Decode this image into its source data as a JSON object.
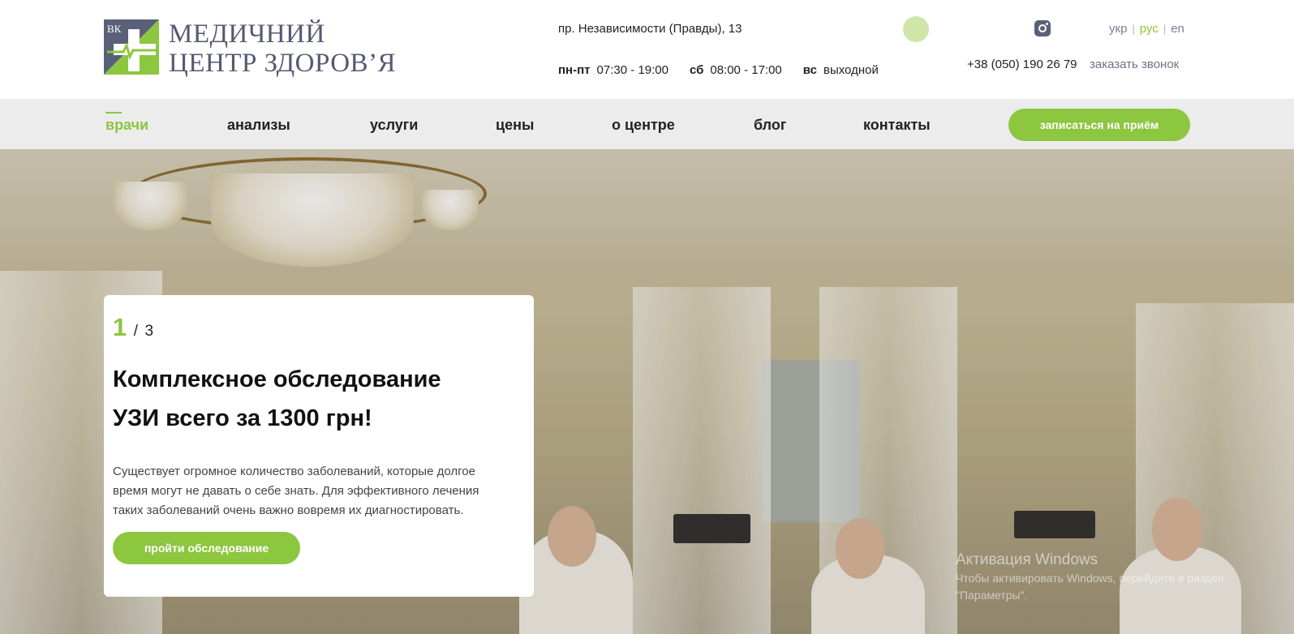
{
  "header": {
    "logo": {
      "badge": "ВК",
      "line1": "МЕДИЧНИЙ",
      "line2": "ЦЕНТР ЗДОРОВ’Я"
    },
    "address": "пр. Независимости (Правды), 13",
    "hours": [
      {
        "label": "пн-пт",
        "value": "07:30 - 19:00"
      },
      {
        "label": "сб",
        "value": "08:00 - 17:00"
      },
      {
        "label": "вс",
        "value": "выходной"
      }
    ],
    "languages": {
      "ukr": "укр",
      "rus": "рус",
      "en": "en",
      "separator": "|",
      "active": "рус"
    },
    "phone": "+38 (050) 190 26 79",
    "callback": "заказать звонок",
    "instagram_icon": "instagram-icon"
  },
  "nav": {
    "items": [
      {
        "label": "врачи",
        "active": true
      },
      {
        "label": "анализы"
      },
      {
        "label": "услуги"
      },
      {
        "label": "цены"
      },
      {
        "label": "о центре"
      },
      {
        "label": "блог"
      },
      {
        "label": "контакты"
      }
    ],
    "cta": "записаться на приём"
  },
  "slide": {
    "current": "1",
    "separator": "/",
    "total": "3",
    "title_line1": "Комплексное обследование",
    "title_line2": "УЗИ всего за 1300 грн!",
    "text": "Существует огромное количество заболеваний, которые долгое время могут не давать о себе знать. Для эффективного лечения таких заболеваний очень важно вовремя их диагностировать.",
    "button": "пройти обследование"
  },
  "watermark": {
    "line1": "Активация Windows",
    "line2": "Чтобы активировать Windows, перейдите в раздел",
    "line3": "\"Параметры\"."
  },
  "colors": {
    "accent": "#8dc63f",
    "logo_text": "#555a72",
    "nav_bg": "#ececec"
  }
}
